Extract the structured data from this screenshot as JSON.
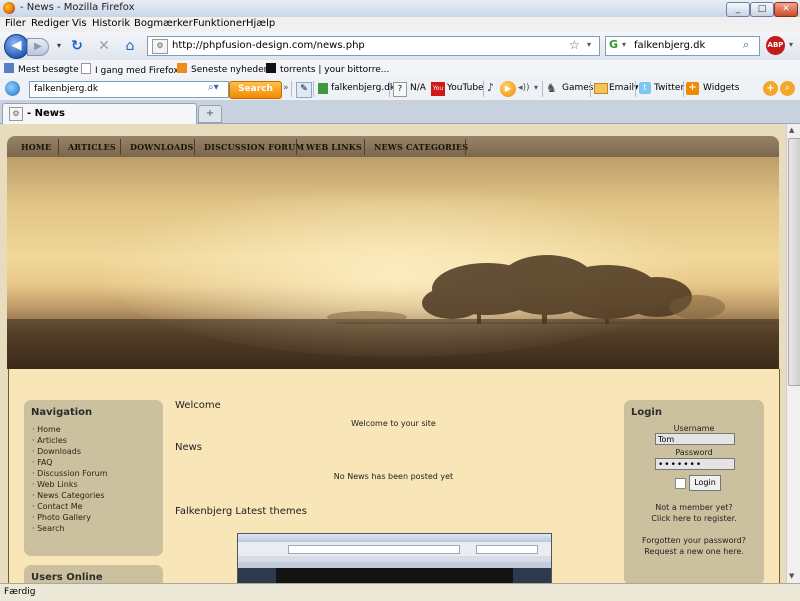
{
  "window": {
    "title": "- News - Mozilla Firefox"
  },
  "menu": [
    "Filer",
    "Rediger",
    "Vis",
    "Historik",
    "Bogmærker",
    "Funktioner",
    "Hjælp"
  ],
  "navbar": {
    "url": "http://phpfusion-design.com/news.php",
    "search_value": "falkenbjerg.dk"
  },
  "bookmarks": [
    "Mest besøgte",
    "I gang med Firefox",
    "Seneste nyheder",
    "torrents | your bittorre..."
  ],
  "search_toolbar": {
    "query": "falkenbjerg.dk",
    "search_button": "Search",
    "site_label": "falkenbjerg.dk",
    "na_label": "N/A",
    "youtube": "YouTube",
    "games": "Games",
    "email": "Email",
    "twitter": "Twitter",
    "widgets": "Widgets"
  },
  "tabs": [
    {
      "label": "- News"
    }
  ],
  "site": {
    "nav": [
      "HOME",
      "ARTICLES",
      "DOWNLOADS",
      "DISCUSSION FORUM",
      "WEB LINKS",
      "NEWS CATEGORIES"
    ],
    "navigation_panel": {
      "title": "Navigation",
      "links": [
        "Home",
        "Articles",
        "Downloads",
        "FAQ",
        "Discussion Forum",
        "Web Links",
        "News Categories",
        "Contact Me",
        "Photo Gallery",
        "Search"
      ]
    },
    "users_online_title": "Users Online",
    "welcome_title": "Welcome",
    "welcome_text": "Welcome to your site",
    "news_title": "News",
    "news_text": "No News has been posted yet",
    "themes_title": "Falkenbjerg Latest themes",
    "login": {
      "title": "Login",
      "username_label": "Username",
      "username_value": "Tom",
      "password_label": "Password",
      "password_value": "•••••••",
      "login_button": "Login",
      "not_member": "Not a member yet?",
      "register": "Click here to register.",
      "forgot": "Forgotten your password?",
      "request": "Request a new one here."
    }
  },
  "status": "Færdig"
}
